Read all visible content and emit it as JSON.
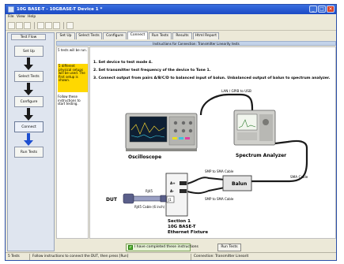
{
  "window": {
    "title": "10G BASE-T - 10GBASE-T Device 1 *"
  },
  "menu": [
    "File",
    "View",
    "Help"
  ],
  "sidebar": {
    "header": "Test Flow",
    "steps": [
      "Set Up",
      "Select Tests",
      "Configure",
      "Connect",
      "Run Tests"
    ],
    "current": "Connect"
  },
  "tabs": [
    "Set Up",
    "Select Tests",
    "Configure",
    "Connect",
    "Run Tests",
    "Results",
    "Html Report"
  ],
  "active_tab": "Connect",
  "instructions_header": "Instructions for Connection: Transmitter Linearity tests",
  "notes": {
    "top": "5 tests will be run.",
    "highlight": "5 different physical setups will be used. The first setup is shown.",
    "follow": "Follow these instructions to start testing."
  },
  "instructions": [
    "1. Set device to test mode 4.",
    "2. Set transmitter test frequency of the device to Tone 1.",
    "3. Connect output from pairs A/B/C/D to balanced input of balun. Unbalanced output of balun to spectrum analyzer."
  ],
  "diagram": {
    "lan_label": "LAN / GPIB to USB",
    "oscilloscope": "Oscilloscope",
    "spectrum": "Spectrum Analyzer",
    "balun": "Balun",
    "sma_cable": "SMA Cable",
    "smp_sma_1": "SMP to SMA Cable",
    "smp_sma_2": "SMP to SMA Cable",
    "a_plus": "A+",
    "a_minus": "A-",
    "j1": "J1",
    "rj45": "RJ45",
    "dut": "DUT",
    "rj45_cable": "RJ45 Cable (6 inch)",
    "fixture_line1": "Section 1",
    "fixture_line2": "10G BASE-T",
    "fixture_line3": "Ethernet Fixture"
  },
  "bottom": {
    "checkbox": "I have completed these instructions",
    "run": "Run Tests"
  },
  "status": {
    "count": "5 Tests",
    "message": "Follow instructions to connect the DUT, then press [Run]",
    "connection": "Connection: Transmitter Linearit"
  }
}
